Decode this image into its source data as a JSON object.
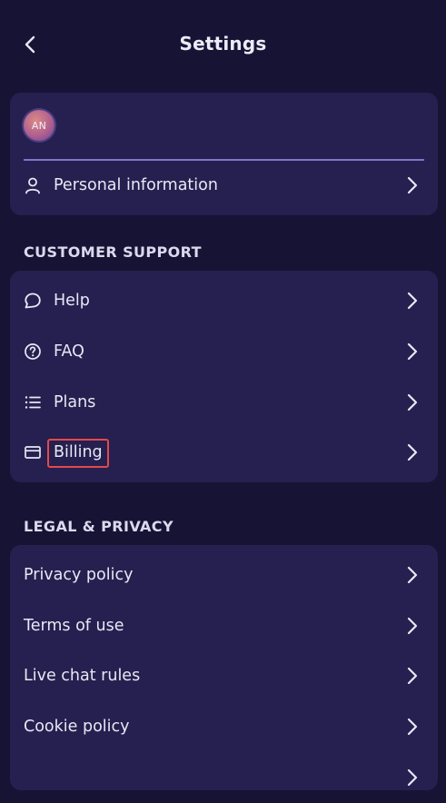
{
  "header": {
    "title": "Settings",
    "back_icon": "chevron-left-icon"
  },
  "profile": {
    "avatar_initials": "AN",
    "personal_info_label": "Personal information",
    "personal_info_icon": "user-icon"
  },
  "customer_support": {
    "title": "CUSTOMER SUPPORT",
    "items": [
      {
        "label": "Help",
        "icon": "chat-bubble-icon"
      },
      {
        "label": "FAQ",
        "icon": "question-circle-icon"
      },
      {
        "label": "Plans",
        "icon": "list-icon"
      },
      {
        "label": "Billing",
        "icon": "card-icon"
      }
    ]
  },
  "legal_privacy": {
    "title": "LEGAL & PRIVACY",
    "items": [
      {
        "label": "Privacy policy"
      },
      {
        "label": "Terms of use"
      },
      {
        "label": "Live chat rules"
      },
      {
        "label": "Cookie policy"
      }
    ]
  },
  "colors": {
    "background": "#161334",
    "card": "#25204f",
    "text": "#e9e7f5",
    "divider": "#7b78c9",
    "highlight": "#e5484d"
  }
}
